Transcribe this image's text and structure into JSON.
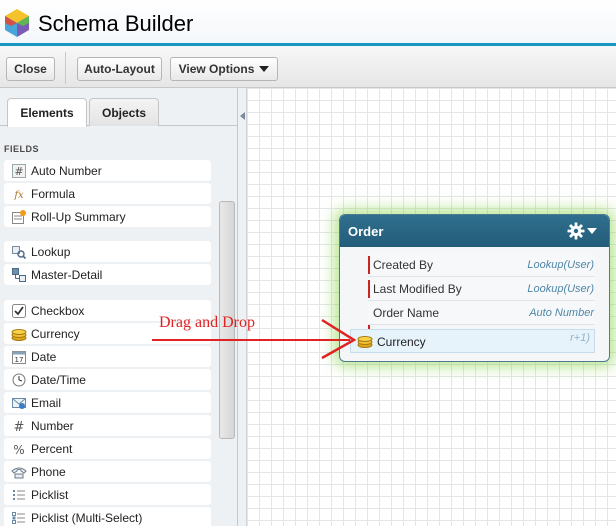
{
  "app": {
    "title": "Schema Builder",
    "logo_icon": "cube-logo-icon"
  },
  "toolbar": {
    "close_label": "Close",
    "auto_layout_label": "Auto-Layout",
    "view_options_label": "View Options"
  },
  "tabs": [
    {
      "label": "Elements",
      "active": true
    },
    {
      "label": "Objects",
      "active": false
    }
  ],
  "fields": {
    "heading": "FIELDS",
    "items": [
      {
        "label": "Auto Number",
        "icon": "hash-icon"
      },
      {
        "label": "Formula",
        "icon": "formula-icon"
      },
      {
        "label": "Roll-Up Summary",
        "icon": "rollup-summary-icon"
      },
      {
        "label": "Lookup",
        "icon": "lookup-icon"
      },
      {
        "label": "Master-Detail",
        "icon": "master-detail-icon"
      },
      {
        "label": "Checkbox",
        "icon": "checkbox-icon"
      },
      {
        "label": "Currency",
        "icon": "coins-icon"
      },
      {
        "label": "Date",
        "icon": "calendar-icon"
      },
      {
        "label": "Date/Time",
        "icon": "clock-icon"
      },
      {
        "label": "Email",
        "icon": "email-icon"
      },
      {
        "label": "Number",
        "icon": "hash-icon"
      },
      {
        "label": "Percent",
        "icon": "percent-icon"
      },
      {
        "label": "Phone",
        "icon": "phone-icon"
      },
      {
        "label": "Picklist",
        "icon": "list-icon"
      },
      {
        "label": "Picklist (Multi-Select)",
        "icon": "multi-list-icon"
      }
    ]
  },
  "order_object": {
    "title": "Order",
    "fields": [
      {
        "name": "Created By",
        "type": "Lookup(User)",
        "required": true
      },
      {
        "name": "Last Modified By",
        "type": "Lookup(User)",
        "required": true
      },
      {
        "name": "Order Name",
        "type": "Auto Number",
        "required": false
      }
    ],
    "dragged_field": {
      "label": "Currency",
      "ghost_text": "r+1)"
    }
  },
  "annotation": {
    "text": "Drag and Drop",
    "color": "#e02222"
  },
  "colors": {
    "header_accent": "#1797c0",
    "card_header": "#2a6888",
    "annotation_red": "#e02222"
  }
}
